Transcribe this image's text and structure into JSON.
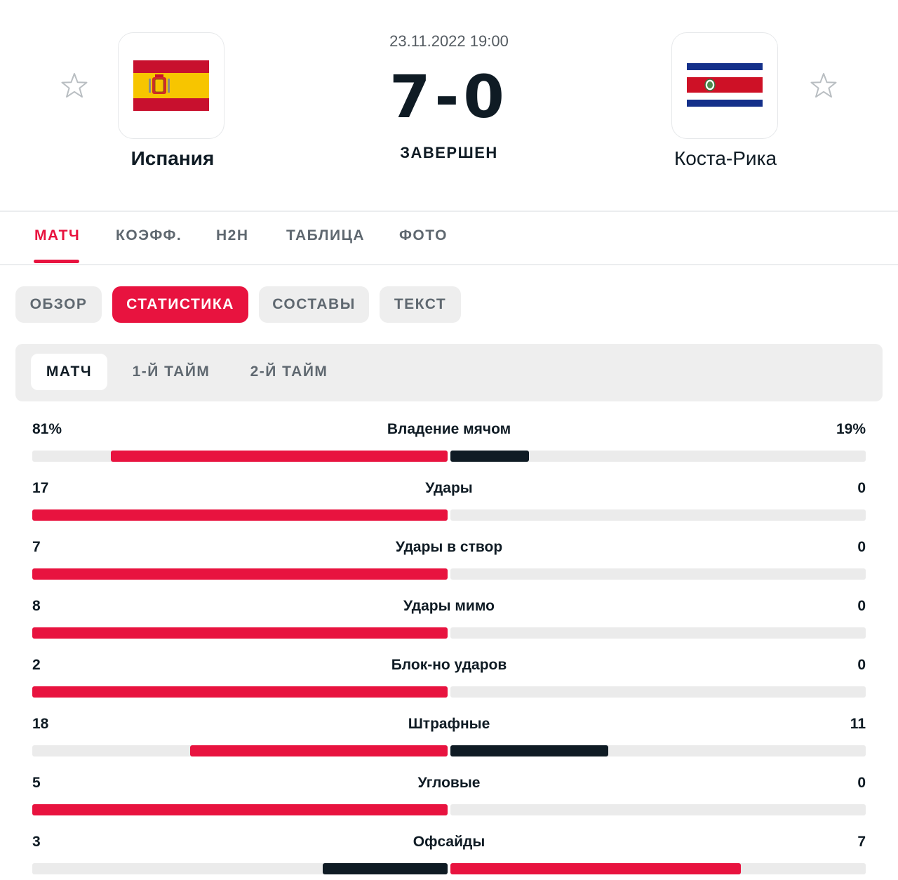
{
  "match": {
    "date": "23.11.2022 19:00",
    "score": "7-0",
    "status": "ЗАВЕРШЕН",
    "home": {
      "name": "Испания",
      "flag": "spain-flag"
    },
    "away": {
      "name": "Коста-Рика",
      "flag": "costa-rica-flag"
    }
  },
  "main_tabs": [
    {
      "label": "МАТЧ",
      "active": true
    },
    {
      "label": "КОЭФФ.",
      "active": false
    },
    {
      "label": "H2H",
      "active": false
    },
    {
      "label": "ТАБЛИЦА",
      "active": false
    },
    {
      "label": "ФОТО",
      "active": false
    }
  ],
  "sub_tabs": [
    {
      "label": "ОБЗОР",
      "active": false
    },
    {
      "label": "СТАТИСТИКА",
      "active": true
    },
    {
      "label": "СОСТАВЫ",
      "active": false
    },
    {
      "label": "ТЕКСТ",
      "active": false
    }
  ],
  "periods": [
    {
      "label": "МАТЧ",
      "active": true
    },
    {
      "label": "1-Й ТАЙМ",
      "active": false
    },
    {
      "label": "2-Й ТАЙМ",
      "active": false
    }
  ],
  "stats": [
    {
      "label": "Владение мячом",
      "home": "81%",
      "away": "19%",
      "home_value": 81,
      "away_value": 19
    },
    {
      "label": "Удары",
      "home": "17",
      "away": "0",
      "home_value": 17,
      "away_value": 0
    },
    {
      "label": "Удары в створ",
      "home": "7",
      "away": "0",
      "home_value": 7,
      "away_value": 0
    },
    {
      "label": "Удары мимо",
      "home": "8",
      "away": "0",
      "home_value": 8,
      "away_value": 0
    },
    {
      "label": "Блок-но ударов",
      "home": "2",
      "away": "0",
      "home_value": 2,
      "away_value": 0
    },
    {
      "label": "Штрафные",
      "home": "18",
      "away": "11",
      "home_value": 18,
      "away_value": 11
    },
    {
      "label": "Угловые",
      "home": "5",
      "away": "0",
      "home_value": 5,
      "away_value": 0
    },
    {
      "label": "Офсайды",
      "home": "3",
      "away": "7",
      "home_value": 3,
      "away_value": 7
    }
  ],
  "colors": {
    "accent": "#e8133f",
    "dark": "#0f1b24",
    "track": "#ebebeb"
  }
}
